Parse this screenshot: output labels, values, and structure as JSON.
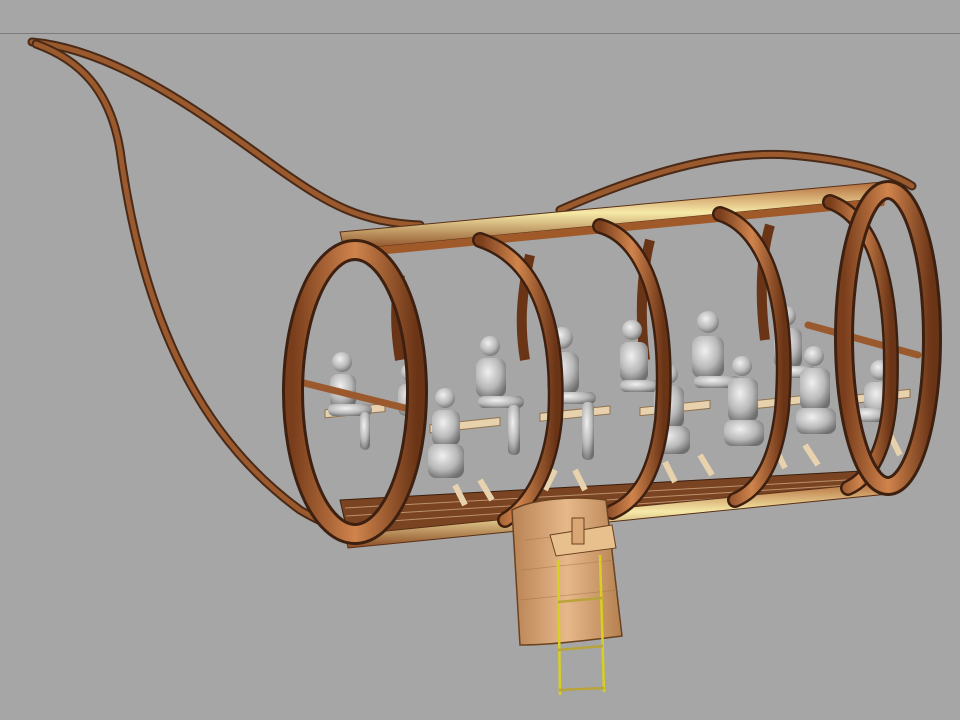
{
  "viewport": {
    "background": "#a6a6a6",
    "rule_color": "#7b7b7b"
  },
  "model": {
    "wood_color": "#9a5a2e",
    "wood_light": "#c98a55",
    "wood_dark": "#4a2a17",
    "trim_color": "#f3e6a6",
    "figure_color": "#c9c9c9",
    "figure_shadow": "#7d7d7d",
    "bench_color": "#e7d2ad",
    "ladder_rope_color": "#d8d020",
    "plank_color": "#d9a775",
    "seated_figures": 12,
    "ring_frames": 6
  }
}
